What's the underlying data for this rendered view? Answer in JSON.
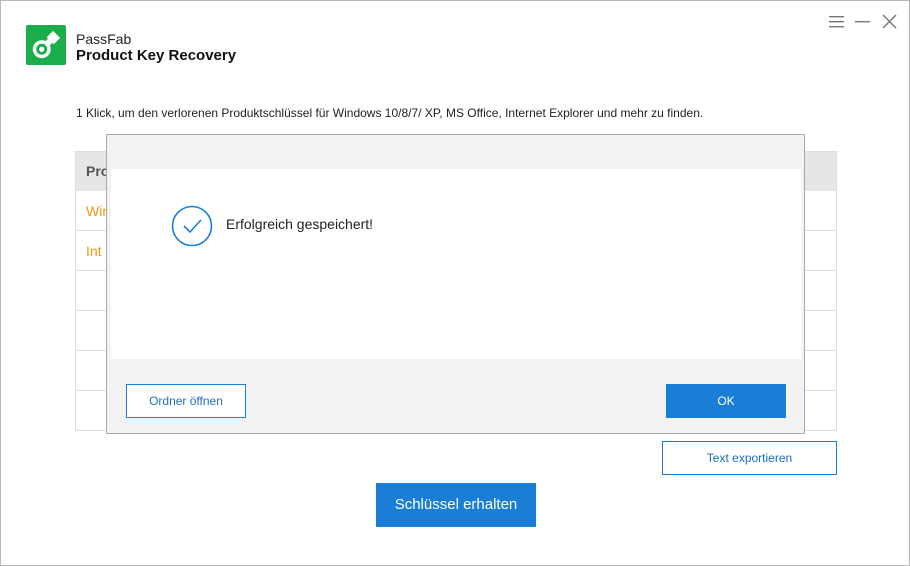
{
  "app": {
    "brand": "PassFab",
    "product": "Product Key Recovery",
    "accent_color": "#1a7ed6",
    "logo_color": "#1aad4b"
  },
  "window_controls": {
    "menu_icon": "hamburger-menu-icon",
    "minimize_icon": "minimize-icon",
    "close_icon": "close-icon"
  },
  "description": "1 Klick, um den verlorenen Produktschlüssel für Windows 10/8/7/ XP, MS Office, Internet Explorer und mehr zu finden.",
  "table": {
    "header_partial": "Pro",
    "rows": [
      {
        "partial_text": "Win"
      },
      {
        "partial_text": "Int"
      },
      {
        "partial_text": ""
      },
      {
        "partial_text": ""
      },
      {
        "partial_text": ""
      },
      {
        "partial_text": ""
      }
    ],
    "row_text_color": "#f0960e"
  },
  "buttons": {
    "export": "Text exportieren",
    "get_key": "Schlüssel erhalten"
  },
  "dialog": {
    "message": "Erfolgreich gespeichert!",
    "icon": "success-check-icon",
    "open_folder": "Ordner öffnen",
    "ok": "OK"
  }
}
